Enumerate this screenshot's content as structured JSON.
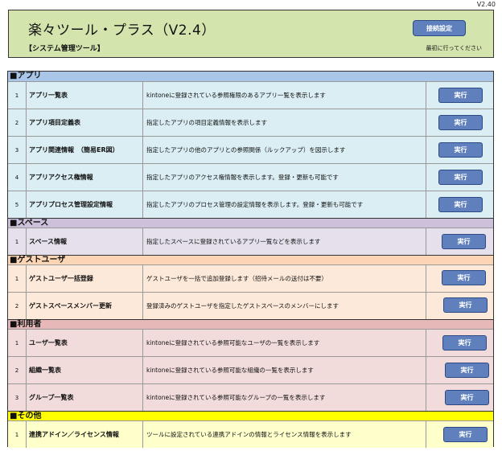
{
  "version_tag": "V2.40",
  "header": {
    "title": "楽々ツール・プラス（V2.4）",
    "subtitle": "【システム管理ツール】",
    "connect_button": "接続設定",
    "connect_note": "最初に行ってください"
  },
  "colors": {
    "header_bg": "#d3e4ad",
    "button_bg": "#5f80bd",
    "app_header": "#a9c6e8",
    "app_row": "#daeef3",
    "space_header": "#ccc0da",
    "space_row": "#e5e0ec",
    "guest_header": "#fcd5b4",
    "guest_row": "#fde9d9",
    "user_header": "#e6b9b8",
    "user_row": "#f2dcdb",
    "other_header": "#ffff00",
    "other_row": "#ffffcc"
  },
  "run_label": "実行",
  "sections": [
    {
      "key": "app",
      "label": "■アプリ",
      "rows": [
        {
          "num": "1",
          "name": "アプリ一覧表",
          "desc": "kintoneに登録されている参照権限のあるアプリ一覧を表示します"
        },
        {
          "num": "2",
          "name": "アプリ項目定義表",
          "desc": "指定したアプリの項目定義情報を表示します"
        },
        {
          "num": "3",
          "name": "アプリ関連情報　（簡易ER図）",
          "desc": "指定したアプリの他のアプリとの参照関係（ルックアップ）を図示します"
        },
        {
          "num": "4",
          "name": "アプリアクセス権情報",
          "desc": "指定したアプリのアクセス権情報を表示します。登録・更新も可能です"
        },
        {
          "num": "5",
          "name": "アプリプロセス管理設定情報",
          "desc": "指定したアプリのプロセス管理の設定情報を表示します。登録・更新も可能です"
        }
      ]
    },
    {
      "key": "space",
      "label": "■スペース",
      "rows": [
        {
          "num": "1",
          "name": "スペース情報",
          "desc": "指定したスペースに登録されているアプリ一覧などを表示します"
        }
      ]
    },
    {
      "key": "guest",
      "label": "■ゲストユーザ",
      "rows": [
        {
          "num": "1",
          "name": "ゲストユーザ一括登録",
          "desc": "ゲストユーザを一括で追加登録します（招待メールの送付は不要）"
        },
        {
          "num": "2",
          "name": "ゲストスペースメンバー更新",
          "desc": "登録済みのゲストユーザを指定したゲストスペースのメンバーにします"
        }
      ]
    },
    {
      "key": "user",
      "label": "■利用者",
      "rows": [
        {
          "num": "1",
          "name": "ユーザ一覧表",
          "desc": "kintoneに登録されている参照可能なユーザの一覧を表示します"
        },
        {
          "num": "2",
          "name": "組織一覧表",
          "desc": "kintoneに登録されている参照可能な組織の一覧を表示します"
        },
        {
          "num": "3",
          "name": "グループ一覧表",
          "desc": "kintoneに登録されている参照可能なグループの一覧を表示します"
        }
      ]
    },
    {
      "key": "other",
      "label": "■その他",
      "rows": [
        {
          "num": "1",
          "name": "連携アドイン／ライセンス情報",
          "desc": "ツールに設定されている連携アドインの情報とライセンス情報を表示します"
        }
      ]
    }
  ]
}
